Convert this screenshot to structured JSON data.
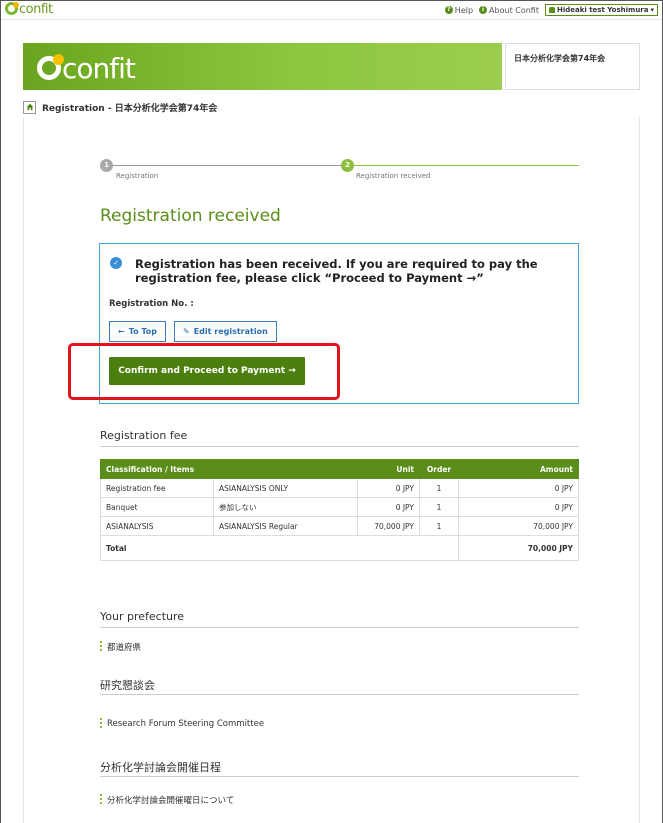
{
  "topbar": {
    "logo": "confit",
    "help": "Help",
    "about": "About Confit",
    "user": "Hideaki test Yoshimura"
  },
  "header": {
    "logo": "confit",
    "conference": "日本分析化学会第74年会"
  },
  "breadcrumb": {
    "text": "Registration - 日本分析化学会第74年会"
  },
  "stepper": {
    "steps": [
      {
        "num": "1",
        "label": "Registration"
      },
      {
        "num": "2",
        "label": "Registration received"
      }
    ]
  },
  "main": {
    "title": "Registration received",
    "notice": "Registration has been received. If you are required to pay the registration fee, please click “Proceed to Payment →”",
    "regno_label": "Registration No. :",
    "to_top": "To Top",
    "edit": "Edit registration",
    "proceed": "Confirm and Proceed to Payment",
    "proceed_arrow": "→"
  },
  "fee": {
    "title": "Registration fee",
    "headers": [
      "Classification / Items",
      "Unit",
      "Order",
      "Amount"
    ],
    "rows": [
      {
        "item": "Registration fee",
        "detail": "ASIANALYSIS ONLY",
        "unit": "0 JPY",
        "order": "1",
        "amount": "0 JPY"
      },
      {
        "item": "Banquet",
        "detail": "参加しない",
        "unit": "0 JPY",
        "order": "1",
        "amount": "0 JPY"
      },
      {
        "item": "ASIANALYSIS",
        "detail": "ASIANALYSIS Regular",
        "unit": "70,000 JPY",
        "order": "1",
        "amount": "70,000 JPY"
      }
    ],
    "total_label": "Total",
    "total_amount": "70,000 JPY"
  },
  "sections": [
    {
      "title": "Your prefecture",
      "item": "都道府県"
    },
    {
      "title": "研究懇談会",
      "item": "Research Forum Steering Committee"
    },
    {
      "title": "分析化学討論会開催日程",
      "item": "分析化学討論会開催曜日について"
    }
  ],
  "colors": {
    "brand_green": "#5a8d1a",
    "info_blue": "#3a8ed6",
    "highlight_red": "#e2131a"
  }
}
